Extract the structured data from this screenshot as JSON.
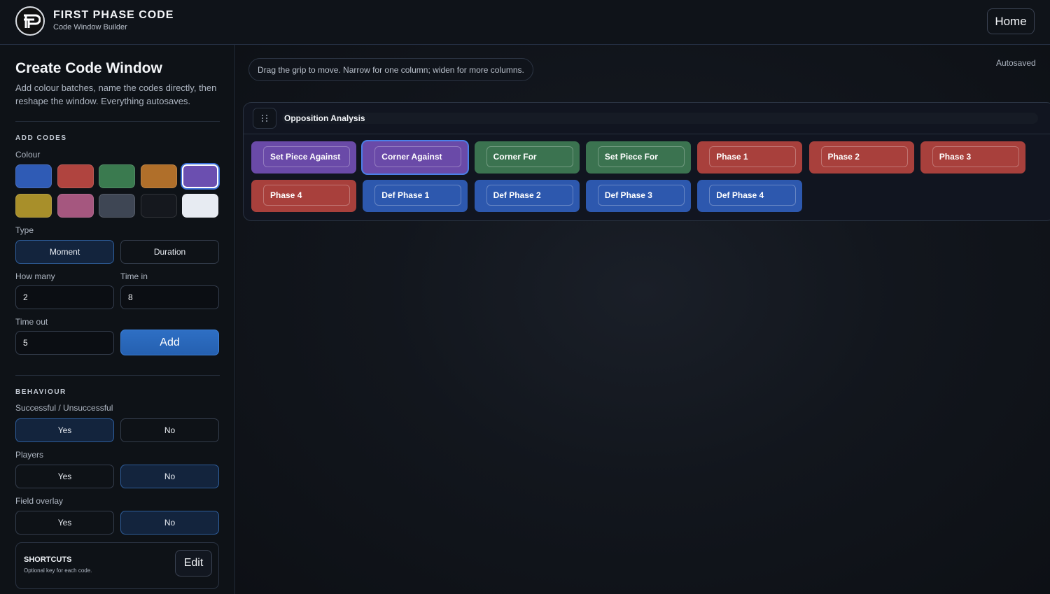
{
  "header": {
    "brand_title": "FIRST PHASE CODE",
    "brand_subtitle": "Code Window Builder",
    "home_label": "Home"
  },
  "sidebar": {
    "title": "Create Code Window",
    "description": "Add colour batches, name the codes directly, then reshape the window. Everything autosaves.",
    "add_codes": {
      "heading": "ADD CODES",
      "colour_label": "Colour",
      "colours": [
        "#2f5bb5",
        "#b0443f",
        "#3a7a4f",
        "#b06f2a",
        "#6b4fb0",
        "#a88f2a",
        "#a5577f",
        "#3e4654",
        "#15181e",
        "#e7ebf2"
      ],
      "selected_colour_index": 4,
      "type_label": "Type",
      "type_options": [
        "Moment",
        "Duration"
      ],
      "type_selected": "Moment",
      "how_many_label": "How many",
      "how_many_value": "2",
      "time_in_label": "Time in",
      "time_in_value": "8",
      "time_out_label": "Time out",
      "time_out_value": "5",
      "add_label": "Add"
    },
    "behaviour": {
      "heading": "BEHAVIOUR",
      "successful_label": "Successful / Unsuccessful",
      "successful_selected": "Yes",
      "players_label": "Players",
      "players_selected": "No",
      "field_overlay_label": "Field overlay",
      "field_overlay_selected": "No",
      "yes_label": "Yes",
      "no_label": "No"
    },
    "shortcuts": {
      "title": "SHORTCUTS",
      "subtitle": "Optional key for each code.",
      "edit_label": "Edit"
    }
  },
  "main": {
    "hint": "Drag the grip to move. Narrow for one column; widen for more columns.",
    "autosaved": "Autosaved",
    "window_title": "Opposition Analysis",
    "codes": [
      {
        "label": "Set Piece Against",
        "color": "#6a4aa8"
      },
      {
        "label": "Corner Against",
        "color": "#6a4aa8",
        "selected": true
      },
      {
        "label": "Corner For",
        "color": "#3b7350"
      },
      {
        "label": "Set Piece For",
        "color": "#3b7350"
      },
      {
        "label": "Phase 1",
        "color": "#a8403c"
      },
      {
        "label": "Phase 2",
        "color": "#a8403c"
      },
      {
        "label": "Phase 3",
        "color": "#a8403c"
      },
      {
        "label": "Phase 4",
        "color": "#a8403c"
      },
      {
        "label": "Def Phase 1",
        "color": "#2d58ae"
      },
      {
        "label": "Def Phase 2",
        "color": "#2d58ae"
      },
      {
        "label": "Def Phase 3",
        "color": "#2d58ae"
      },
      {
        "label": "Def Phase 4",
        "color": "#2d58ae"
      }
    ]
  }
}
